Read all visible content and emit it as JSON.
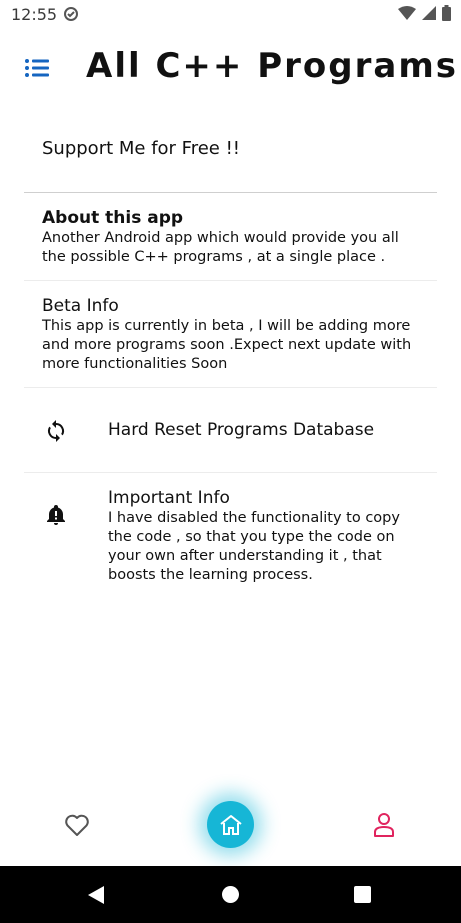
{
  "status_bar": {
    "time": "12:55",
    "icons": [
      "sync-icon",
      "wifi-icon",
      "signal-icon",
      "battery-icon"
    ]
  },
  "header": {
    "title": "All C++ Programs",
    "menu_icon": "list-menu-icon",
    "accent_color": "#1565c0"
  },
  "support": {
    "label": "Support Me for Free !!"
  },
  "about": {
    "title": "About this app",
    "lines": [
      "Another Android app which would provide you all",
      "the possible C++ programs , at a single place ."
    ]
  },
  "beta": {
    "title": "Beta Info",
    "lines": [
      "This app is currently in beta , I will be adding more",
      "and more programs soon .Expect next update with",
      "more functionalities Soon"
    ]
  },
  "reset": {
    "icon": "sync-icon",
    "label": "Hard Reset Programs Database"
  },
  "important": {
    "icon": "alert-bell-icon",
    "title": "Important Info",
    "lines": [
      "I have disabled the functionality to copy",
      "the code , so that you type the code on",
      "your own after understanding it , that",
      "boosts the learning process."
    ]
  },
  "bottom_nav": {
    "items": [
      {
        "icon": "heart-icon",
        "color": "#555555"
      },
      {
        "icon": "home-icon",
        "color": "#16b6d6",
        "active": true
      },
      {
        "icon": "profile-icon",
        "color": "#e0245e"
      }
    ]
  },
  "system_nav": {
    "icons": [
      "back-icon",
      "home-circle-icon",
      "recent-apps-icon"
    ]
  }
}
